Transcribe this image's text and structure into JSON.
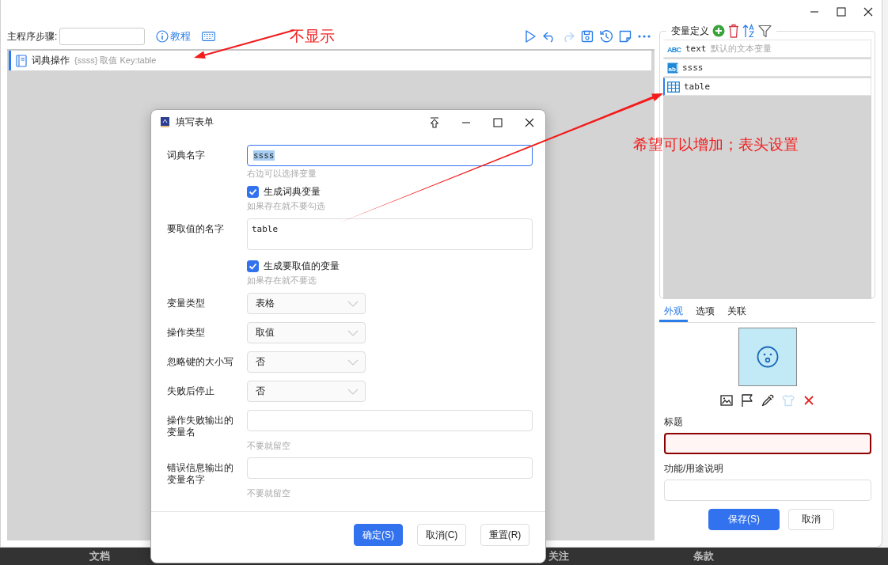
{
  "toolbar": {
    "steps_label": "主程序步骤:",
    "tutorial_link": "教程",
    "actions": [
      {
        "kind": "run",
        "disabled": false
      },
      {
        "kind": "undo",
        "disabled": false
      },
      {
        "kind": "redo",
        "disabled": true
      },
      {
        "kind": "save",
        "disabled": false
      },
      {
        "kind": "history",
        "disabled": false
      },
      {
        "kind": "note",
        "disabled": false
      },
      {
        "kind": "more",
        "disabled": false
      }
    ]
  },
  "step_row": {
    "title": "词典操作",
    "detail": "{ssss} 取值 Key:table",
    "selected": true
  },
  "variables": {
    "title": "变量定义",
    "items": [
      {
        "kind": "text",
        "icon_text": "ABC",
        "name": "text",
        "description": "默认的文本变量",
        "selected": false
      },
      {
        "kind": "dict",
        "icon_text": "ab",
        "name": "ssss",
        "selected": false
      },
      {
        "kind": "table",
        "name": "table",
        "selected": true
      }
    ]
  },
  "properties": {
    "tabs": [
      {
        "label": "外观",
        "selected": true
      },
      {
        "label": "选项",
        "selected": false
      },
      {
        "label": "关联",
        "selected": false
      }
    ],
    "preview_tools": [
      {
        "kind": "image",
        "disabled": false
      },
      {
        "kind": "flag",
        "disabled": false
      },
      {
        "kind": "picker",
        "disabled": false
      },
      {
        "kind": "shirt",
        "disabled": true
      },
      {
        "kind": "delete",
        "disabled": false
      }
    ],
    "title_label": "标题",
    "title_field": {
      "invalid": true
    },
    "description_label": "功能/用途说明",
    "buttons": [
      {
        "label": "保存(S)",
        "kind": "primary"
      },
      {
        "label": "取消",
        "kind": "default"
      }
    ]
  },
  "dialog": {
    "title": "填写表单",
    "fields": [
      {
        "kind": "text",
        "label": "词典名字",
        "value": "ssss",
        "focused": true,
        "hint": "右边可以选择变量"
      },
      {
        "kind": "checkbox",
        "label": "生成词典变量",
        "checked": true,
        "hint": "如果存在就不要勾选"
      },
      {
        "kind": "textarea",
        "label": "要取值的名字",
        "value": "table"
      },
      {
        "kind": "checkbox",
        "label": "生成要取值的变量",
        "checked": true,
        "hint": "如果存在就不要选"
      },
      {
        "kind": "select",
        "label": "变量类型",
        "value": "表格"
      },
      {
        "kind": "select",
        "label": "操作类型",
        "value": "取值"
      },
      {
        "kind": "select",
        "label": "忽略键的大小写",
        "value": "否"
      },
      {
        "kind": "select",
        "label": "失败后停止",
        "value": "否"
      },
      {
        "kind": "text",
        "label": "操作失败输出的变量名",
        "focused": false,
        "hint": "不要就留空"
      },
      {
        "kind": "text",
        "label": "错误信息输出的变量名字",
        "focused": false,
        "hint": "不要就留空"
      }
    ],
    "buttons": [
      {
        "label": "确定(S)",
        "kind": "primary"
      },
      {
        "label": "取消(C)",
        "kind": "default"
      },
      {
        "label": "重置(R)",
        "kind": "default"
      }
    ]
  },
  "footer_links": [
    "文档",
    "关注",
    "条款"
  ],
  "annotations": [
    {
      "text": "不显示"
    },
    {
      "text": "希望可以增加；表头设置"
    }
  ]
}
